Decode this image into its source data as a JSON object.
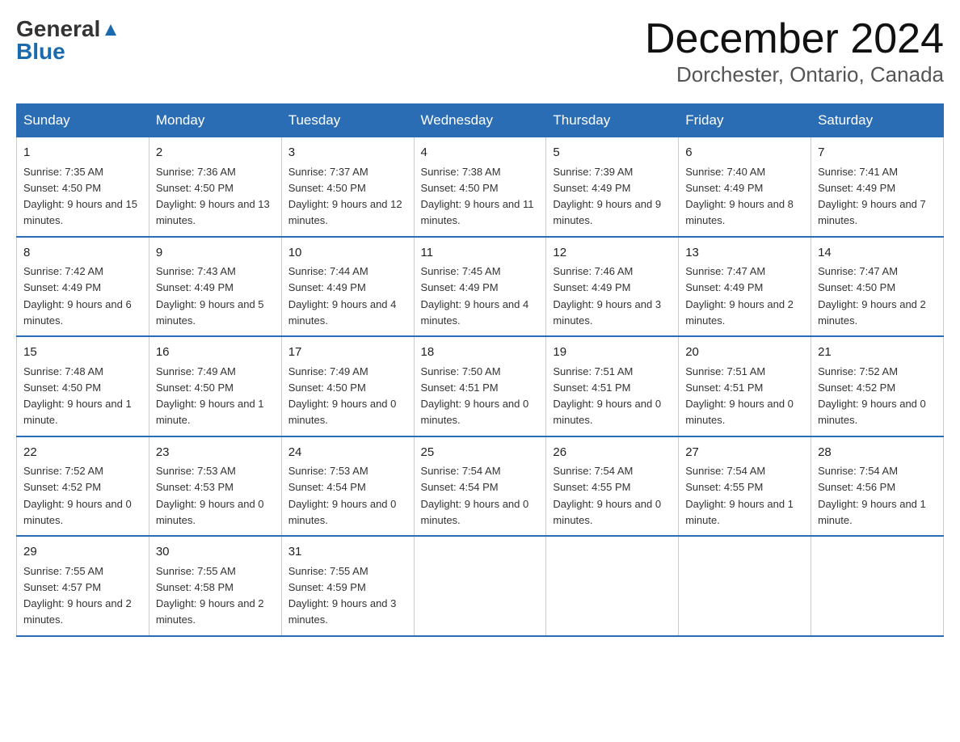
{
  "logo": {
    "general": "General",
    "blue": "Blue"
  },
  "title": "December 2024",
  "location": "Dorchester, Ontario, Canada",
  "headers": [
    "Sunday",
    "Monday",
    "Tuesday",
    "Wednesday",
    "Thursday",
    "Friday",
    "Saturday"
  ],
  "weeks": [
    [
      {
        "day": "1",
        "sunrise": "7:35 AM",
        "sunset": "4:50 PM",
        "daylight": "9 hours and 15 minutes."
      },
      {
        "day": "2",
        "sunrise": "7:36 AM",
        "sunset": "4:50 PM",
        "daylight": "9 hours and 13 minutes."
      },
      {
        "day": "3",
        "sunrise": "7:37 AM",
        "sunset": "4:50 PM",
        "daylight": "9 hours and 12 minutes."
      },
      {
        "day": "4",
        "sunrise": "7:38 AM",
        "sunset": "4:50 PM",
        "daylight": "9 hours and 11 minutes."
      },
      {
        "day": "5",
        "sunrise": "7:39 AM",
        "sunset": "4:49 PM",
        "daylight": "9 hours and 9 minutes."
      },
      {
        "day": "6",
        "sunrise": "7:40 AM",
        "sunset": "4:49 PM",
        "daylight": "9 hours and 8 minutes."
      },
      {
        "day": "7",
        "sunrise": "7:41 AM",
        "sunset": "4:49 PM",
        "daylight": "9 hours and 7 minutes."
      }
    ],
    [
      {
        "day": "8",
        "sunrise": "7:42 AM",
        "sunset": "4:49 PM",
        "daylight": "9 hours and 6 minutes."
      },
      {
        "day": "9",
        "sunrise": "7:43 AM",
        "sunset": "4:49 PM",
        "daylight": "9 hours and 5 minutes."
      },
      {
        "day": "10",
        "sunrise": "7:44 AM",
        "sunset": "4:49 PM",
        "daylight": "9 hours and 4 minutes."
      },
      {
        "day": "11",
        "sunrise": "7:45 AM",
        "sunset": "4:49 PM",
        "daylight": "9 hours and 4 minutes."
      },
      {
        "day": "12",
        "sunrise": "7:46 AM",
        "sunset": "4:49 PM",
        "daylight": "9 hours and 3 minutes."
      },
      {
        "day": "13",
        "sunrise": "7:47 AM",
        "sunset": "4:49 PM",
        "daylight": "9 hours and 2 minutes."
      },
      {
        "day": "14",
        "sunrise": "7:47 AM",
        "sunset": "4:50 PM",
        "daylight": "9 hours and 2 minutes."
      }
    ],
    [
      {
        "day": "15",
        "sunrise": "7:48 AM",
        "sunset": "4:50 PM",
        "daylight": "9 hours and 1 minute."
      },
      {
        "day": "16",
        "sunrise": "7:49 AM",
        "sunset": "4:50 PM",
        "daylight": "9 hours and 1 minute."
      },
      {
        "day": "17",
        "sunrise": "7:49 AM",
        "sunset": "4:50 PM",
        "daylight": "9 hours and 0 minutes."
      },
      {
        "day": "18",
        "sunrise": "7:50 AM",
        "sunset": "4:51 PM",
        "daylight": "9 hours and 0 minutes."
      },
      {
        "day": "19",
        "sunrise": "7:51 AM",
        "sunset": "4:51 PM",
        "daylight": "9 hours and 0 minutes."
      },
      {
        "day": "20",
        "sunrise": "7:51 AM",
        "sunset": "4:51 PM",
        "daylight": "9 hours and 0 minutes."
      },
      {
        "day": "21",
        "sunrise": "7:52 AM",
        "sunset": "4:52 PM",
        "daylight": "9 hours and 0 minutes."
      }
    ],
    [
      {
        "day": "22",
        "sunrise": "7:52 AM",
        "sunset": "4:52 PM",
        "daylight": "9 hours and 0 minutes."
      },
      {
        "day": "23",
        "sunrise": "7:53 AM",
        "sunset": "4:53 PM",
        "daylight": "9 hours and 0 minutes."
      },
      {
        "day": "24",
        "sunrise": "7:53 AM",
        "sunset": "4:54 PM",
        "daylight": "9 hours and 0 minutes."
      },
      {
        "day": "25",
        "sunrise": "7:54 AM",
        "sunset": "4:54 PM",
        "daylight": "9 hours and 0 minutes."
      },
      {
        "day": "26",
        "sunrise": "7:54 AM",
        "sunset": "4:55 PM",
        "daylight": "9 hours and 0 minutes."
      },
      {
        "day": "27",
        "sunrise": "7:54 AM",
        "sunset": "4:55 PM",
        "daylight": "9 hours and 1 minute."
      },
      {
        "day": "28",
        "sunrise": "7:54 AM",
        "sunset": "4:56 PM",
        "daylight": "9 hours and 1 minute."
      }
    ],
    [
      {
        "day": "29",
        "sunrise": "7:55 AM",
        "sunset": "4:57 PM",
        "daylight": "9 hours and 2 minutes."
      },
      {
        "day": "30",
        "sunrise": "7:55 AM",
        "sunset": "4:58 PM",
        "daylight": "9 hours and 2 minutes."
      },
      {
        "day": "31",
        "sunrise": "7:55 AM",
        "sunset": "4:59 PM",
        "daylight": "9 hours and 3 minutes."
      },
      null,
      null,
      null,
      null
    ]
  ]
}
